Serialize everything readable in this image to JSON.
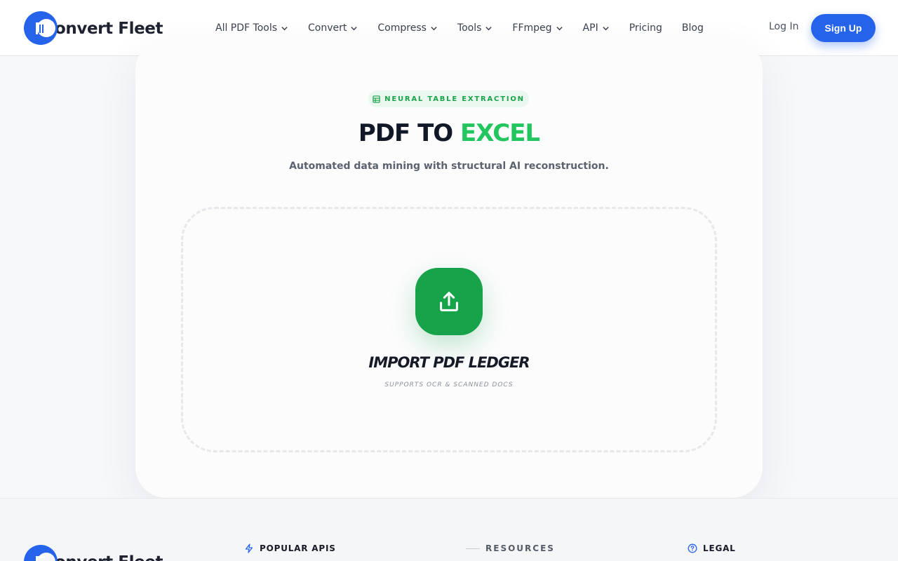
{
  "brand": {
    "name": "onvert Fleet",
    "accent": "#2563eb"
  },
  "nav": {
    "items": [
      {
        "label": "All PDF Tools",
        "dropdown": true
      },
      {
        "label": "Convert",
        "dropdown": true
      },
      {
        "label": "Compress",
        "dropdown": true
      },
      {
        "label": "Tools",
        "dropdown": true
      },
      {
        "label": "FFmpeg",
        "dropdown": true
      },
      {
        "label": "API",
        "dropdown": true
      },
      {
        "label": "Pricing",
        "dropdown": false
      },
      {
        "label": "Blog",
        "dropdown": false
      }
    ],
    "login_label": "Log In",
    "signup_label": "Sign Up"
  },
  "hero": {
    "badge_icon": "table-icon",
    "badge": "NEURAL TABLE EXTRACTION",
    "title_main": "PDF TO ",
    "title_accent": "EXCEL",
    "accent_color": "#22c55e",
    "subtitle": "Automated data mining with structural AI reconstruction."
  },
  "upload": {
    "icon": "upload-icon",
    "label": "IMPORT PDF LEDGER",
    "sub": "SUPPORTS OCR & SCANNED DOCS",
    "button_color": "#16a34a"
  },
  "footer": {
    "columns": [
      {
        "icon": "lightning-icon",
        "label": "POPULAR APIS"
      },
      {
        "icon": "dash",
        "label": "RESOURCES"
      },
      {
        "icon": "help-circle-icon",
        "label": "LEGAL"
      }
    ]
  }
}
